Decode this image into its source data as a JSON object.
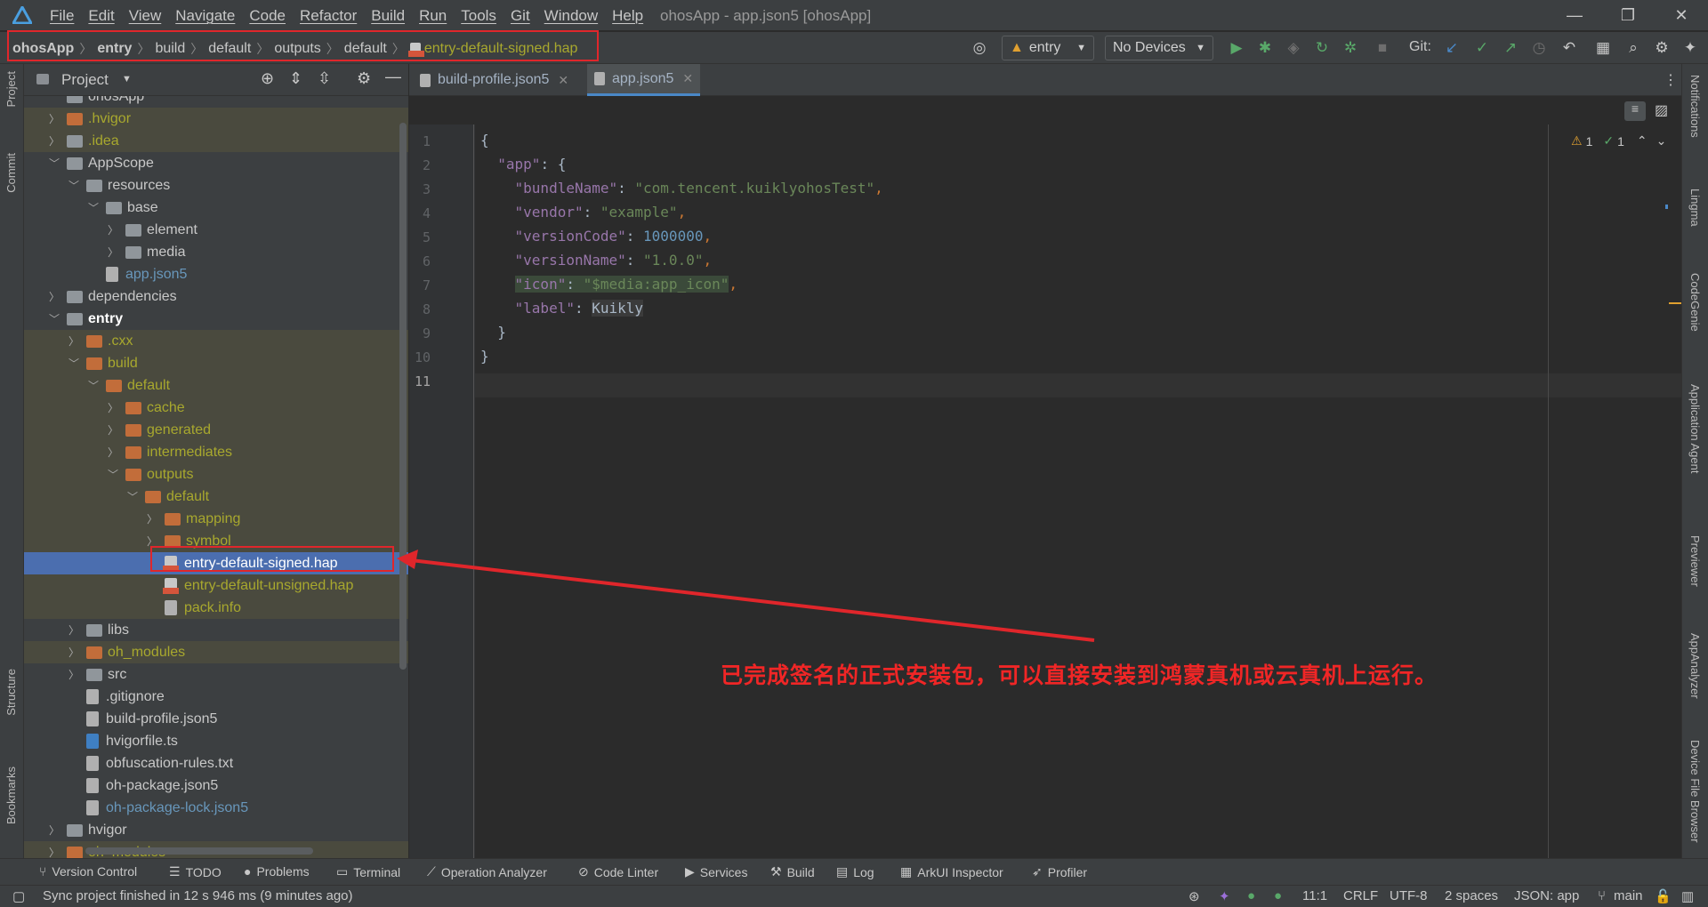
{
  "menu": [
    "File",
    "Edit",
    "View",
    "Navigate",
    "Code",
    "Refactor",
    "Build",
    "Run",
    "Tools",
    "Git",
    "Window",
    "Help"
  ],
  "window_title": "ohosApp - app.json5 [ohosApp]",
  "breadcrumb": [
    "ohosApp",
    "entry",
    "build",
    "default",
    "outputs",
    "default",
    "entry-default-signed.hap"
  ],
  "toolbar": {
    "run_config": "entry",
    "device": "No Devices",
    "git_label": "Git:"
  },
  "project_panel": {
    "title": "Project"
  },
  "tree": [
    {
      "label": "ohosApp",
      "indent": 1,
      "type": "folder",
      "hl": false,
      "color": "gray"
    },
    {
      "label": ".hvigor",
      "indent": 1,
      "type": "ofolder",
      "hl": true,
      "color": "olive",
      "chev": ">"
    },
    {
      "label": ".idea",
      "indent": 1,
      "type": "folder",
      "hl": true,
      "color": "olive",
      "chev": ">"
    },
    {
      "label": "AppScope",
      "indent": 1,
      "type": "folder",
      "hl": false,
      "color": "gray",
      "chev": "v"
    },
    {
      "label": "resources",
      "indent": 2,
      "type": "folder",
      "hl": false,
      "color": "gray",
      "chev": "v"
    },
    {
      "label": "base",
      "indent": 3,
      "type": "folder",
      "hl": false,
      "color": "gray",
      "chev": "v"
    },
    {
      "label": "element",
      "indent": 4,
      "type": "folder",
      "hl": false,
      "color": "gray",
      "chev": ">"
    },
    {
      "label": "media",
      "indent": 4,
      "type": "folder",
      "hl": false,
      "color": "gray",
      "chev": ">"
    },
    {
      "label": "app.json5",
      "indent": 3,
      "type": "file",
      "hl": false,
      "color": "blue"
    },
    {
      "label": "dependencies",
      "indent": 1,
      "type": "folder",
      "hl": false,
      "color": "gray",
      "chev": ">"
    },
    {
      "label": "entry",
      "indent": 1,
      "type": "folder",
      "hl": false,
      "color": "white",
      "chev": "v",
      "bold": true
    },
    {
      "label": ".cxx",
      "indent": 2,
      "type": "ofolder",
      "hl": true,
      "color": "olive",
      "chev": ">"
    },
    {
      "label": "build",
      "indent": 2,
      "type": "ofolder",
      "hl": true,
      "color": "olive",
      "chev": "v"
    },
    {
      "label": "default",
      "indent": 3,
      "type": "ofolder",
      "hl": true,
      "color": "olive",
      "chev": "v"
    },
    {
      "label": "cache",
      "indent": 4,
      "type": "ofolder",
      "hl": true,
      "color": "olive",
      "chev": ">"
    },
    {
      "label": "generated",
      "indent": 4,
      "type": "ofolder",
      "hl": true,
      "color": "olive",
      "chev": ">"
    },
    {
      "label": "intermediates",
      "indent": 4,
      "type": "ofolder",
      "hl": true,
      "color": "olive",
      "chev": ">"
    },
    {
      "label": "outputs",
      "indent": 4,
      "type": "ofolder",
      "hl": true,
      "color": "olive",
      "chev": "v"
    },
    {
      "label": "default",
      "indent": 5,
      "type": "ofolder",
      "hl": true,
      "color": "olive",
      "chev": "v"
    },
    {
      "label": "mapping",
      "indent": 6,
      "type": "ofolder",
      "hl": true,
      "color": "olive",
      "chev": ">"
    },
    {
      "label": "symbol",
      "indent": 6,
      "type": "ofolder",
      "hl": true,
      "color": "olive",
      "chev": ">"
    },
    {
      "label": "entry-default-signed.hap",
      "indent": 6,
      "type": "hap",
      "sel": true,
      "color": "white"
    },
    {
      "label": "entry-default-unsigned.hap",
      "indent": 6,
      "type": "hap",
      "hl": true,
      "color": "olive"
    },
    {
      "label": "pack.info",
      "indent": 6,
      "type": "file",
      "hl": true,
      "color": "olive"
    },
    {
      "label": "libs",
      "indent": 2,
      "type": "folder",
      "hl": false,
      "color": "gray",
      "chev": ">"
    },
    {
      "label": "oh_modules",
      "indent": 2,
      "type": "ofolder",
      "hl": true,
      "color": "olive",
      "chev": ">"
    },
    {
      "label": "src",
      "indent": 2,
      "type": "folder",
      "hl": false,
      "color": "gray",
      "chev": ">"
    },
    {
      "label": ".gitignore",
      "indent": 2,
      "type": "file",
      "hl": false,
      "color": "gray"
    },
    {
      "label": "build-profile.json5",
      "indent": 2,
      "type": "file",
      "hl": false,
      "color": "gray"
    },
    {
      "label": "hvigorfile.ts",
      "indent": 2,
      "type": "ts",
      "hl": false,
      "color": "gray"
    },
    {
      "label": "obfuscation-rules.txt",
      "indent": 2,
      "type": "file",
      "hl": false,
      "color": "gray"
    },
    {
      "label": "oh-package.json5",
      "indent": 2,
      "type": "file",
      "hl": false,
      "color": "gray"
    },
    {
      "label": "oh-package-lock.json5",
      "indent": 2,
      "type": "file",
      "hl": false,
      "color": "blue"
    },
    {
      "label": "hvigor",
      "indent": 1,
      "type": "folder",
      "hl": false,
      "color": "gray",
      "chev": ">"
    },
    {
      "label": "oh_modules",
      "indent": 1,
      "type": "ofolder",
      "hl": true,
      "color": "olive",
      "chev": ">"
    }
  ],
  "tabs": [
    {
      "label": "build-profile.json5",
      "active": false
    },
    {
      "label": "app.json5",
      "active": true
    }
  ],
  "line_numbers": [
    "1",
    "2",
    "3",
    "4",
    "5",
    "6",
    "7",
    "8",
    "9",
    "10",
    "11"
  ],
  "code": {
    "l1": "{",
    "l2_key": "\"app\"",
    "l2_rest": ": {",
    "l3_key": "\"bundleName\"",
    "l3_val": "\"com.tencent.kuiklyohosTest\"",
    "l4_key": "\"vendor\"",
    "l4_val": "\"example\"",
    "l5_key": "\"versionCode\"",
    "l5_val": "1000000",
    "l6_key": "\"versionName\"",
    "l6_val": "\"1.0.0\"",
    "l7_key": "\"icon\"",
    "l7_val": "\"$media:app_icon\"",
    "l8_key": "\"label\"",
    "l8_val": "Kuikly",
    "l9": "}",
    "l10": "}"
  },
  "inspections": {
    "warnings": "1",
    "ok": "1"
  },
  "annotation": "已完成签名的正式安装包，可以直接安装到鸿蒙真机或云真机上运行。",
  "left_tools": [
    "Project",
    "Commit",
    "Structure",
    "Bookmarks"
  ],
  "right_tools": [
    "Notifications",
    "Lingma",
    "CodeGenie",
    "Application Agent",
    "Previewer",
    "AppAnalyzer",
    "Device File Browser"
  ],
  "bottom_tools": [
    "Version Control",
    "TODO",
    "Problems",
    "Terminal",
    "Operation Analyzer",
    "Code Linter",
    "Services",
    "Build",
    "Log",
    "ArkUI Inspector",
    "Profiler"
  ],
  "status": {
    "message": "Sync project finished in 12 s 946 ms (9 minutes ago)",
    "position": "11:1",
    "line_sep": "CRLF",
    "encoding": "UTF-8",
    "indent": "2 spaces",
    "schema": "JSON: app",
    "branch": "main"
  },
  "colors": {
    "accent": "#4b6eaf",
    "annotation_red": "#e0262b"
  }
}
